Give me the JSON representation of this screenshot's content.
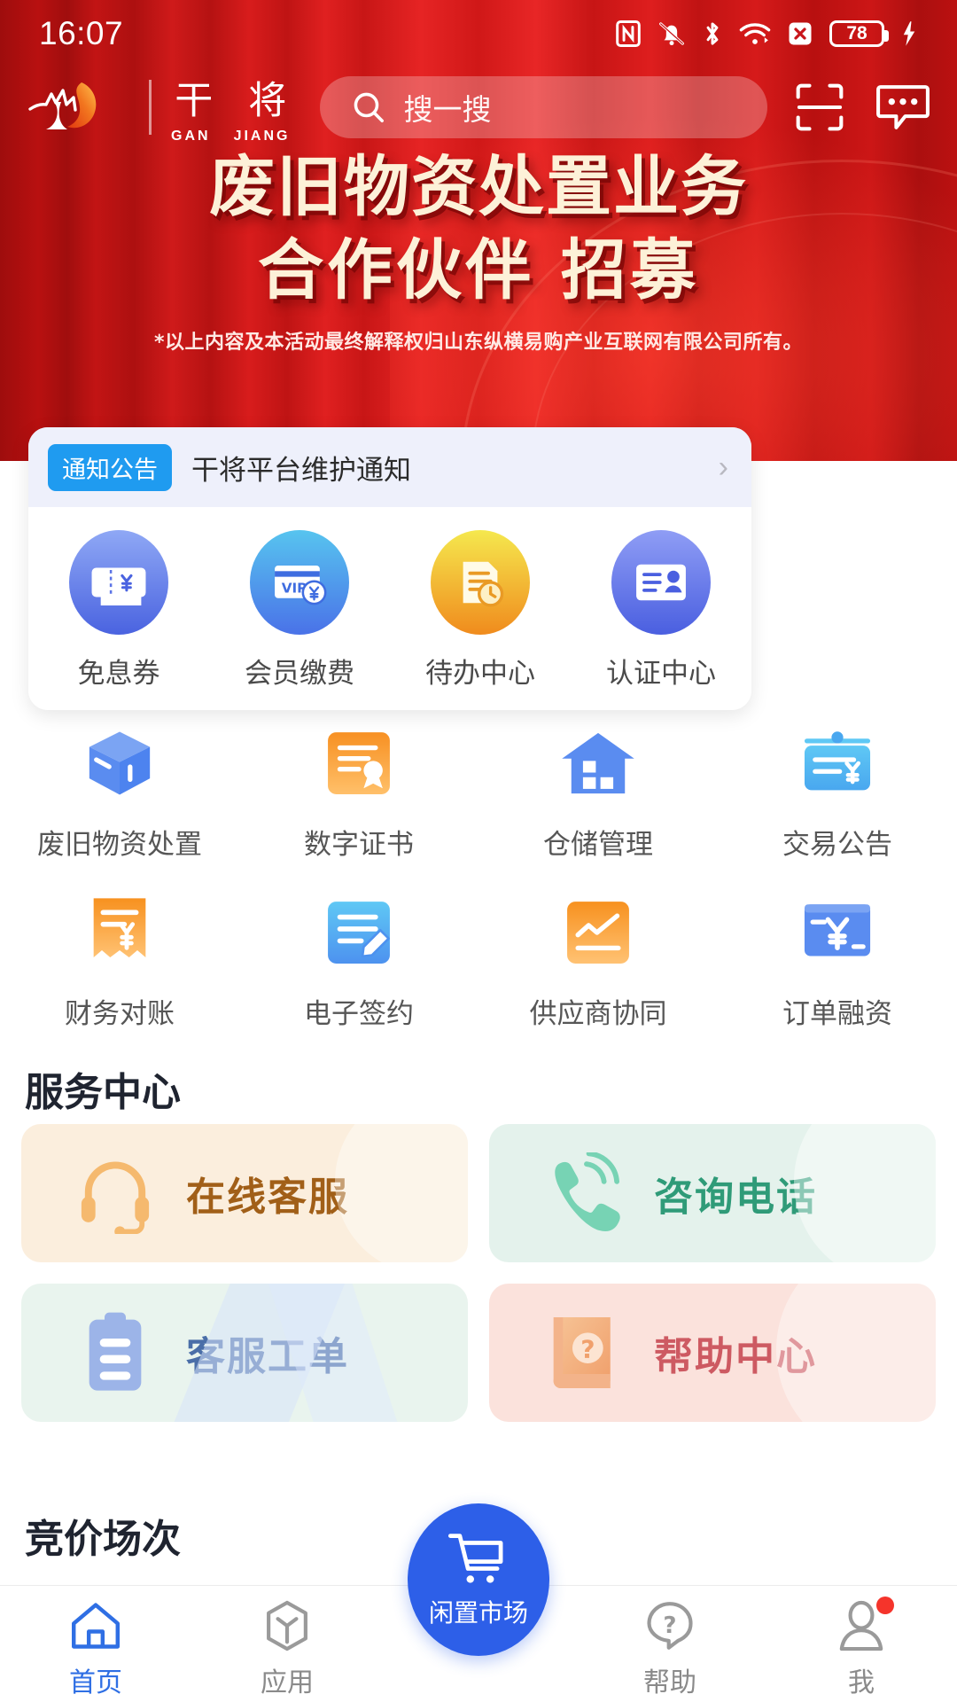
{
  "status_bar": {
    "time": "16:07",
    "battery_level": "78",
    "icons": [
      "nfc-icon",
      "bell-muted-icon",
      "bluetooth-icon",
      "wifi-icon",
      "sim-off-icon",
      "battery-icon",
      "charging-bolt-icon"
    ]
  },
  "header": {
    "brand_cn": [
      "干",
      "将"
    ],
    "brand_en": [
      "GAN",
      "JIANG"
    ],
    "search_placeholder": "搜一搜",
    "scan_icon": "scan-icon",
    "message_icon": "message-icon"
  },
  "banner": {
    "line1": "废旧物资处置业务",
    "line2": "合作伙伴 招募",
    "note": "*以上内容及本活动最终解释权归山东纵横易购产业互联网有限公司所有。"
  },
  "notice": {
    "tag": "通知公告",
    "text": "干将平台维护通知",
    "chevron": "›"
  },
  "quick_actions": [
    {
      "label": "免息券",
      "icon": "coupon-yuan-icon",
      "color": "#6c8cf0"
    },
    {
      "label": "会员缴费",
      "icon": "vip-card-icon",
      "color": "#4aa8ea"
    },
    {
      "label": "待办中心",
      "icon": "todo-clock-icon",
      "color": "#f5a623"
    },
    {
      "label": "认证中心",
      "icon": "id-card-icon",
      "color": "#6c7ef0"
    }
  ],
  "app_grid": [
    {
      "label": "废旧物资处置",
      "icon": "cube-box-icon",
      "color": "#5a8cf0"
    },
    {
      "label": "数字证书",
      "icon": "certificate-icon",
      "color": "#f7a23b"
    },
    {
      "label": "仓储管理",
      "icon": "warehouse-home-icon",
      "color": "#5a8cf0"
    },
    {
      "label": "交易公告",
      "icon": "announcement-board-icon",
      "color": "#4cb8ef"
    },
    {
      "label": "财务对账",
      "icon": "receipt-yuan-icon",
      "color": "#f7a23b"
    },
    {
      "label": "电子签约",
      "icon": "sign-document-icon",
      "color": "#4cb8ef"
    },
    {
      "label": "供应商协同",
      "icon": "trend-chart-icon",
      "color": "#f7a23b"
    },
    {
      "label": "订单融资",
      "icon": "finance-card-icon",
      "color": "#5a8cf0"
    }
  ],
  "service_center": {
    "title": "服务中心",
    "cards": [
      {
        "label": "在线客服",
        "icon": "headset-icon",
        "bg": "#fbeedd",
        "fg": "#a15f18",
        "icon_color": "#f5b96e"
      },
      {
        "label": "咨询电话",
        "icon": "phone-ring-icon",
        "bg": "#e4f2ec",
        "fg": "#2f9b78",
        "icon_color": "#77d3b4"
      },
      {
        "label": "客服工单",
        "icon": "clipboard-icon",
        "bg": "#e9f4ee",
        "fg": "#4a6ea8",
        "icon_color": "#9cb4e8"
      },
      {
        "label": "帮助中心",
        "icon": "help-book-icon",
        "bg": "#fbe2dc",
        "fg": "#cd5a62",
        "icon_color": "#f3b38a"
      }
    ]
  },
  "auction": {
    "title": "竞价场次"
  },
  "tabbar": {
    "fab": {
      "label": "闲置市场",
      "icon": "cart-icon",
      "color": "#2d5fe8"
    },
    "items": [
      {
        "label": "首页",
        "icon": "home-icon",
        "active": true,
        "badge": false
      },
      {
        "label": "应用",
        "icon": "apps-cube-icon",
        "active": false,
        "badge": false
      },
      {
        "label": "帮助",
        "icon": "help-chat-icon",
        "active": false,
        "badge": false
      },
      {
        "label": "我",
        "icon": "user-icon",
        "active": false,
        "badge": true
      }
    ]
  }
}
